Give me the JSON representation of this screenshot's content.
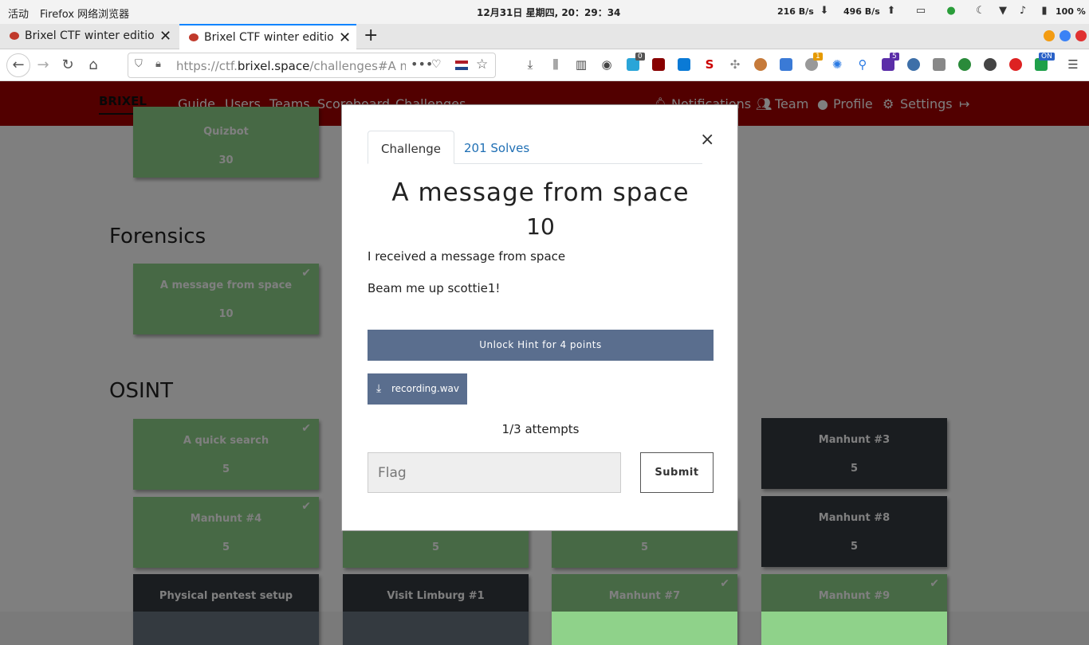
{
  "system_bar": {
    "activities": "活动",
    "app": "Firefox 网络浏览器",
    "clock": "12月31日 星期四, 20：29：34",
    "net_down": "216 B/s",
    "net_up": "496 B/s",
    "battery": "100 %"
  },
  "browser": {
    "tabs": [
      {
        "title": "Brixel CTF winter edition"
      },
      {
        "title": "Brixel CTF winter edition"
      }
    ],
    "url_prefix": "https://ctf.",
    "url_domain": "brixel.space",
    "url_path": "/challenges#A me",
    "ext_badges": [
      "0",
      "1",
      "5",
      "ON"
    ]
  },
  "site": {
    "logo": "BRIXEL",
    "nav_left": [
      "Guide",
      "Users",
      "Teams",
      "Scoreboard",
      "Challenges"
    ],
    "nav_right": [
      "Notifications",
      "Team",
      "Profile",
      "Settings"
    ]
  },
  "board": {
    "sections": [
      "Forensics",
      "OSINT"
    ],
    "cards": [
      {
        "name": "Quizbot",
        "value": "30",
        "solved": true
      },
      {
        "name": "A message from space",
        "value": "10",
        "solved": true
      },
      {
        "name": "A quick search",
        "value": "5",
        "solved": true
      },
      {
        "name": "Manhunt #3",
        "value": "5",
        "solved": false
      },
      {
        "name": "Manhunt #4",
        "value": "5",
        "solved": true
      },
      {
        "name": "",
        "value": "5",
        "solved": true
      },
      {
        "name": "",
        "value": "5",
        "solved": true
      },
      {
        "name": "Manhunt #8",
        "value": "5",
        "solved": false
      },
      {
        "name": "Physical pentest setup",
        "value": "",
        "solved": false
      },
      {
        "name": "Visit Limburg #1",
        "value": "",
        "solved": false
      },
      {
        "name": "Manhunt #7",
        "value": "",
        "solved": true
      },
      {
        "name": "Manhunt #9",
        "value": "",
        "solved": true
      }
    ]
  },
  "modal": {
    "tab_challenge": "Challenge",
    "tab_solves": "201 Solves",
    "title": "A message from space",
    "value": "10",
    "desc1": "I received a message from space",
    "desc2": "Beam me up scottie1!",
    "hint_button": "Unlock Hint for 4 points",
    "file": "recording.wav",
    "attempts": "1/3 attempts",
    "flag_placeholder": "Flag",
    "submit": "Submit"
  },
  "colors": {
    "site_nav": "#a40000",
    "solved_card": "#8fd28a",
    "unsolved_card": "#343a40",
    "modal_button": "#5a6e8e"
  }
}
